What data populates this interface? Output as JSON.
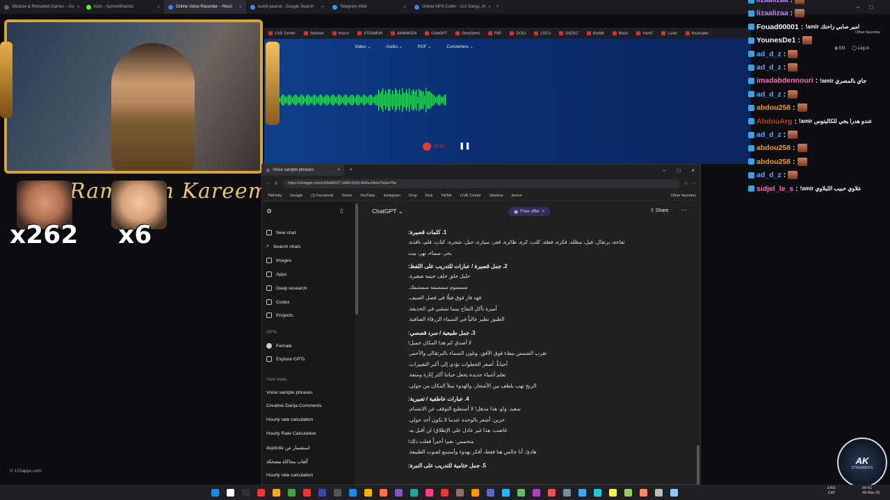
{
  "browser_tabs": [
    {
      "label": "Skidrow & Reloaded Games – Do",
      "active": false
    },
    {
      "label": "Kick – ItsAmirBhands",
      "active": false
    },
    {
      "label": "Online Voice Recorder – Reco",
      "active": true
    },
    {
      "label": "bumit peanut - Google Search",
      "active": false
    },
    {
      "label": "Telegram Web",
      "active": false
    },
    {
      "label": "Online MP3 Cutter - Cut Songs, M",
      "active": false
    }
  ],
  "tab_new": "+",
  "recording_tooltip": "recording",
  "top_bookmarks": [
    "LIVE Center",
    "Skidrow",
    "Horror",
    "STEAMUN",
    "AIMHAVEN",
    "ChatGPT",
    "DeepSeek",
    "FitG",
    "DODI",
    "1337x",
    "GEEKZ",
    "Reddit",
    "Mods",
    "Yaml7",
    "Lurkit",
    "Keymailer",
    "IIROK",
    "Ubisoft"
  ],
  "other_favorites": "Other favorites",
  "recorder": {
    "menu": [
      "Video",
      "Audio",
      "PDF",
      "Converters"
    ],
    "timer": "00:18",
    "lang": "EN",
    "login": "Log in"
  },
  "overlay": {
    "banner": "Ramadan Kareem",
    "counter1": "x262",
    "counter2": "x6",
    "footer_url": "© 123apps.com"
  },
  "gpt_window": {
    "tab_title": "Voice sample phrases",
    "url": "https://chatgpt.com/c/69af4627-1d98-832b-8d0a-b4ee7bcbe70a",
    "bookmarks": [
      "TikFinity",
      "Google",
      "(1) Facebook",
      "Gmail",
      "YouTube",
      "Instagram",
      "Drop",
      "Kick",
      "TikTok",
      "LIVE Center",
      "Skidrow",
      "Horror"
    ],
    "other_favorites": "Other favorites",
    "nav": [
      "New chat",
      "Search chats",
      "Images",
      "Apps",
      "Deep research",
      "Codex",
      "Projects"
    ],
    "gpts_header": "GPTs",
    "gpts": [
      "Female",
      "Explore GPTs"
    ],
    "your_chats_header": "Your chats",
    "chats": [
      "Voice sample phrases",
      "Creative Darija Comments",
      "Hourly rate calculation",
      "Hourly Rate Calculation",
      "duplicite استفسار عن",
      "ألعاب محاكاة مضحكة",
      "Hourly rate calculation"
    ],
    "model": "ChatGPT",
    "free_offer": "Free offer",
    "share": "Share",
    "sections": [
      {
        "heading": "1. كلمات قصيرة:",
        "lines": [
          "تفاحة، برتقال، فيل، مظلة، فكرة، قطة، كلب، كرة، طائرة، قفز، سيارة، جبل، شجرة، كتاب، قلم، نافذة،",
          "بحر، سماء، نهر، بيت"
        ]
      },
      {
        "heading": "2. جمل قصيرة / عبارات للتدريب على اللفظ:",
        "lines": [
          "خليل خلق خلف خيمة صغيرة.",
          "سمسوم سمسمه سمسمك.",
          "فهد فاز فوق فيلًا في فصل الصيف.",
          "أميرة تأكل التفاح بينما تمشي في الحديقة.",
          "الطيور تطير عالياً في السماء الزرقاء الصافية."
        ]
      },
      {
        "heading": "3. جمل طبيعية / سرد قصصي:",
        "lines": [
          "لا أصدق كم هذا المكان جميل!",
          "تغرب الشمس ببطء فوق الأفق، وتلون السماء بالبرتقالي والأحمر.",
          "أحياناً، أصغر الخطوات تؤدي إلى أكبر التغييرات.",
          "تعلم أشياء جديدة يجعل حياتنا أكثر إثارة ومتعة.",
          "الريح تهب بلطف بين الأشجار، والهدوء يملأ المكان من حولي."
        ]
      },
      {
        "heading": "4. عبارات عاطفية / تعبيرية:",
        "lines": [
          "سعيد: واو، هذا مذهل! لا أستطيع التوقف عن الابتسام.",
          "حزين: أشعر بالوحدة عندما لا يكون أحد حولي.",
          "غاضب: هذا غير عادل على الإطلاق! لن أقبل به.",
          "متحمس: نعم! أخيراً فعلت ذلك!",
          "هادئ: أنا جالس هنا فقط، أفكر بهدوء وأستمع لصوت الطبيعة."
        ]
      },
      {
        "heading": "5. جمل ختامية للتدريب على النبرة:",
        "lines": []
      }
    ]
  },
  "stream_chat": [
    {
      "user": "lizaalizaa",
      "msg": "",
      "color": "#c084fc"
    },
    {
      "user": "lizaalizaa",
      "msg": "",
      "color": "#c084fc"
    },
    {
      "user": "Fouad00001",
      "msg": "!amir امير صابي زاحتك",
      "color": "#f5f5f5"
    },
    {
      "user": "YounesDe1",
      "msg": "",
      "color": "#f5f5f5"
    },
    {
      "user": "ad_d_z",
      "msg": "",
      "color": "#60a5fa"
    },
    {
      "user": "ad_d_z",
      "msg": "",
      "color": "#60a5fa"
    },
    {
      "user": "imadabdennouri",
      "msg": "!amir جاي بالمصري",
      "color": "#f472b6"
    },
    {
      "user": "ad_d_z",
      "msg": "",
      "color": "#60a5fa"
    },
    {
      "user": "abdou258",
      "msg": "",
      "color": "#f59e0b"
    },
    {
      "user": "AbdouArg",
      "msg": "!amir عندو هدرا يجي للكاليتوس",
      "color": "#c2410c"
    },
    {
      "user": "ad_d_z",
      "msg": "",
      "color": "#60a5fa"
    },
    {
      "user": "abdou258",
      "msg": "",
      "color": "#f59e0b"
    },
    {
      "user": "abdou258",
      "msg": "",
      "color": "#f59e0b"
    },
    {
      "user": "ad_d_z",
      "msg": "",
      "color": "#60a5fa"
    },
    {
      "user": "sidjel_le_s",
      "msg": "!amir علاوي حبيب الليلاوي",
      "color": "#f472b6"
    }
  ],
  "watermark": {
    "line1": "AK",
    "line2": "STREAMERS"
  },
  "taskbar": {
    "lang": "ENG",
    "region": "CAT",
    "time": "09:42",
    "date": "09-Mar-26"
  },
  "colors": {
    "accent_recorder": "#0b2f73",
    "gold_frame": "#d7a43c",
    "rec_red": "#e53935"
  }
}
